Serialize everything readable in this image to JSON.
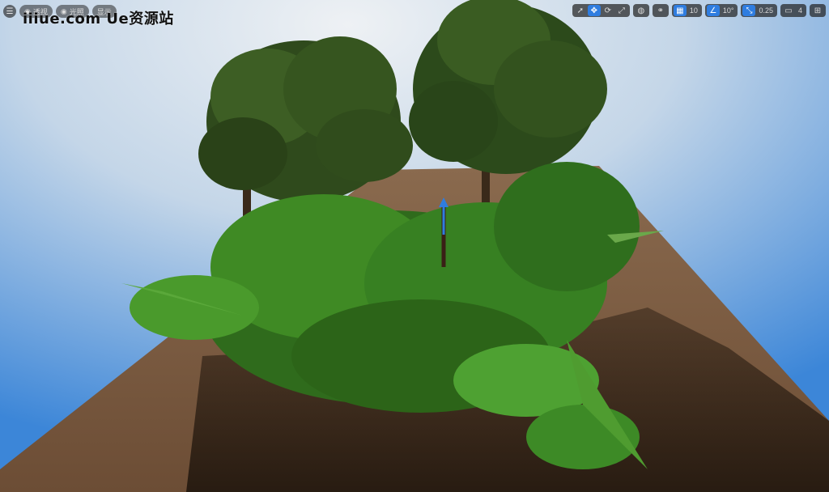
{
  "viewport": {
    "menu_icon": "hamburger-icon",
    "left_pills": [
      {
        "icon": "view-icon",
        "label": "透视"
      },
      {
        "icon": "light-icon",
        "label": "光照"
      },
      {
        "icon": "show-icon",
        "label": "显示"
      }
    ],
    "watermark": "iiiue.com  Ue资源站"
  },
  "toolbar": {
    "select_icon": "cursor-icon",
    "translate_icon": "move-icon",
    "rotate_icon": "rotate-icon",
    "scale_icon": "scale-icon",
    "world_icon": "globe-icon",
    "surface_snap_icon": "snap-icon",
    "grid_snap_value": "10",
    "rotation_snap_value": "10°",
    "scale_snap_value": "0.25",
    "camera_speed_value": "4",
    "layout_icon": "viewport-layout-icon"
  },
  "colors": {
    "sky_top": "#d9e4ee",
    "sky_side": "#3f88d9",
    "ground": "#7a5a40",
    "active_accent": "#2f7de0"
  }
}
